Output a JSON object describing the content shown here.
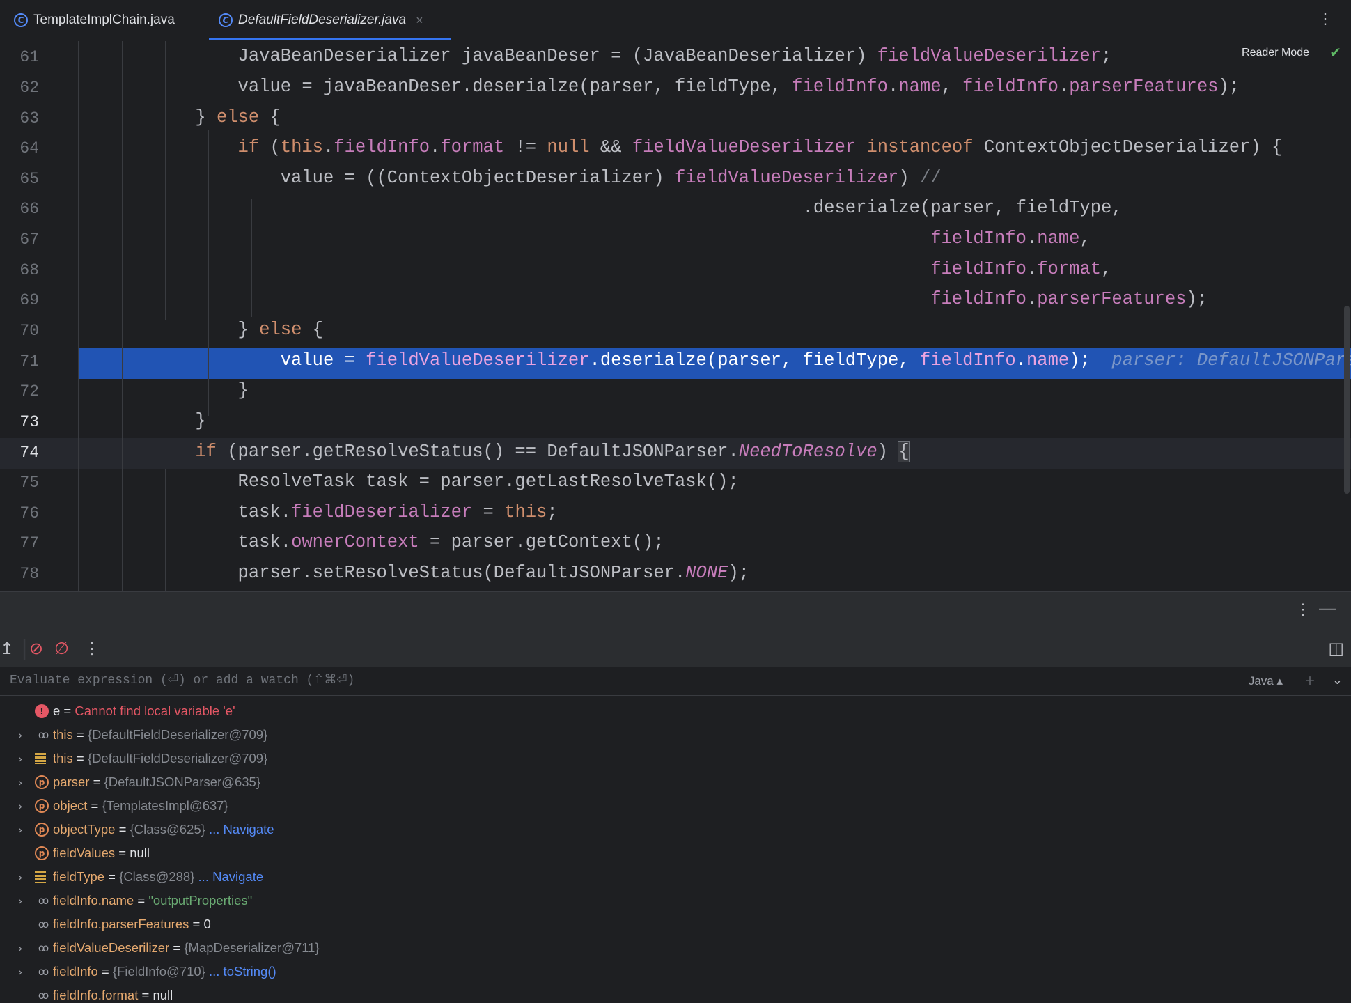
{
  "tabs": [
    {
      "label": "TemplateImplChain.java",
      "icon": "class-icon"
    },
    {
      "label": "DefaultFieldDeserializer.java",
      "icon": "class-icon",
      "active": true
    }
  ],
  "editor": {
    "reader_mode": "Reader Mode",
    "line_numbers": [
      "61",
      "62",
      "63",
      "64",
      "65",
      "66",
      "67",
      "68",
      "69",
      "70",
      "71",
      "72",
      "73",
      "74",
      "75",
      "76",
      "77",
      "78"
    ],
    "current_line": "74",
    "execution_line": "71",
    "inline_hint": "parser: DefaultJSONPars"
  },
  "eval": {
    "placeholder": "Evaluate expression (⏎) or add a watch (⇧⌘⏎)",
    "language": "Java"
  },
  "variables": [
    {
      "name": "e",
      "eq": " = ",
      "value": "Cannot find local variable 'e'",
      "icon": "error-icon",
      "expandable": false,
      "kind": "err"
    },
    {
      "name": "this",
      "eq": " = ",
      "value": "{DefaultFieldDeserializer@709}",
      "icon": "watch-icon",
      "expandable": true
    },
    {
      "name": "this",
      "eq": " = ",
      "value": "{DefaultFieldDeserializer@709}",
      "icon": "field-icon",
      "expandable": true
    },
    {
      "name": "parser",
      "eq": " = ",
      "value": "{DefaultJSONParser@635}",
      "icon": "parameter-icon",
      "expandable": true
    },
    {
      "name": "object",
      "eq": " = ",
      "value": "{TemplatesImpl@637}",
      "icon": "parameter-icon",
      "expandable": true
    },
    {
      "name": "objectType",
      "eq": " = ",
      "value": "{Class@625}",
      "link": "... Navigate",
      "icon": "parameter-icon",
      "expandable": true
    },
    {
      "name": "fieldValues",
      "eq": " = ",
      "value": "null",
      "icon": "parameter-icon",
      "expandable": false,
      "kind": "plain"
    },
    {
      "name": "fieldType",
      "eq": " = ",
      "value": "{Class@288}",
      "link": "... Navigate",
      "icon": "field-icon",
      "expandable": true
    },
    {
      "name": "fieldInfo.name",
      "eq": " = ",
      "value": "\"outputProperties\"",
      "icon": "watch-icon",
      "expandable": true,
      "kind": "str"
    },
    {
      "name": "fieldInfo.parserFeatures",
      "eq": " = ",
      "value": "0",
      "icon": "watch-icon",
      "expandable": false,
      "kind": "plain"
    },
    {
      "name": "fieldValueDeserilizer",
      "eq": " = ",
      "value": "{MapDeserializer@711}",
      "icon": "watch-icon",
      "expandable": true
    },
    {
      "name": "fieldInfo",
      "eq": " = ",
      "value": "{FieldInfo@710}",
      "link": "... toString()",
      "icon": "watch-icon",
      "expandable": true
    },
    {
      "name": "fieldInfo.format",
      "eq": " = ",
      "value": "null",
      "icon": "watch-icon",
      "expandable": false,
      "kind": "plain"
    }
  ],
  "colors": {
    "accent": "#3574f0",
    "execution_line": "#2154b4",
    "keyword": "#cf8e6d",
    "field": "#c77dbb"
  }
}
